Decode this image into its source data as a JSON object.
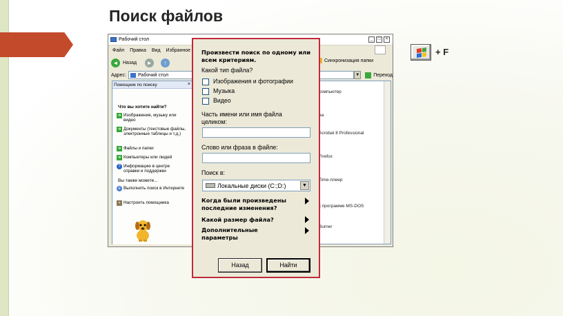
{
  "slide": {
    "title": "Поиск файлов",
    "shortcut": "+ F",
    "accent_color": "#c44a2c"
  },
  "explorer": {
    "title": "Рабочий стол",
    "window_controls": [
      "_",
      "□",
      "×"
    ],
    "menu": [
      "Файл",
      "Правка",
      "Вид",
      "Избранное"
    ],
    "toolbar": {
      "back": "Назад",
      "sync": "Синхронизация папки"
    },
    "address_label": "Адрес:",
    "address_value": "Рабочий стол",
    "go_label": "Переход",
    "pane": {
      "header": "Помощник по поиску",
      "question": "Что вы хотите найти?",
      "tasks": [
        {
          "icon": "arrow-icon",
          "label": "Изображения, музыку или видео"
        },
        {
          "icon": "arrow-icon",
          "label": "Документы (текстовые файлы, электронные таблицы и т.д.)"
        },
        {
          "icon": "arrow-icon",
          "label": "Файлы и папки"
        },
        {
          "icon": "arrow-icon",
          "label": "Компьютеры или людей"
        },
        {
          "icon": "help-icon",
          "label": "Информацию в центре справки и поддержки"
        }
      ],
      "also": "Вы также можете...",
      "extra": [
        {
          "icon": "internet-icon",
          "label": "Выполнить поиск в Интернете"
        },
        {
          "icon": "assistant-icon",
          "label": "Настроить помощника"
        }
      ]
    },
    "listing": [
      "компьютер",
      "на",
      "Acrobat 8 Professional",
      "Firefox",
      "Time-плеер",
      "к программе MS-DOS",
      "Burner"
    ]
  },
  "dialog": {
    "heading": "Произвести поиск по одному или всем критериям.",
    "type_label": "Какой тип файла?",
    "checkboxes": [
      {
        "label": "Изображения и фотографии",
        "checked": false
      },
      {
        "label": "Музыка",
        "checked": false
      },
      {
        "label": "Видео",
        "checked": false
      }
    ],
    "name_label": "Часть имени или имя файла целиком:",
    "name_value": "",
    "phrase_label": "Слово или фраза в файле:",
    "phrase_value": "",
    "lookin_label": "Поиск в:",
    "lookin_value": "Локальные диски (C:;D:)",
    "expanders": [
      "Когда были произведены последние изменения?",
      "Какой размер файла?",
      "Дополнительные параметры"
    ],
    "back_button": "Назад",
    "search_button": "Найти",
    "border_color": "#c0283a"
  }
}
